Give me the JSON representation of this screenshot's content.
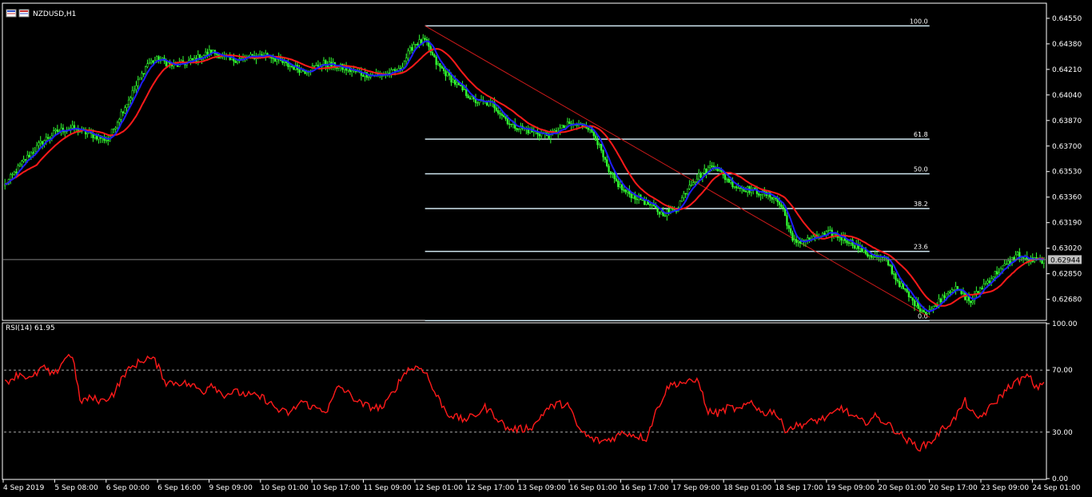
{
  "window": {
    "symbol_title": "NZDUSD,H1",
    "current_price": "0.62944",
    "icons": [
      "chart-window-icon",
      "chart-properties-icon"
    ]
  },
  "colors": {
    "background": "#000000",
    "panel_border": "#ffffff",
    "candle": "#33ff33",
    "fast_ma": "#1e1eff",
    "slow_ma": "#ff1a1a",
    "fib_line": "#cfe6f0",
    "trend_line": "#cc1a1a",
    "rsi_line": "#ff1a1a",
    "level_line": "#c0c0c0",
    "price_line": "#808080",
    "price_tag_bg": "#c0c0c0"
  },
  "chart_data": [
    {
      "type": "candlestick",
      "title": "NZDUSD,H1",
      "ylim": [
        0.6255,
        0.6464
      ],
      "y_ticks": [
        "0.64550",
        "0.64380",
        "0.64210",
        "0.64040",
        "0.63870",
        "0.63700",
        "0.63530",
        "0.63360",
        "0.63190",
        "0.63020",
        "0.62850",
        "0.62680"
      ],
      "x_ticks": [
        "4 Sep 2019",
        "5 Sep 08:00",
        "6 Sep 00:00",
        "6 Sep 16:00",
        "9 Sep 09:00",
        "10 Sep 01:00",
        "10 Sep 17:00",
        "11 Sep 09:00",
        "12 Sep 01:00",
        "12 Sep 17:00",
        "13 Sep 09:00",
        "16 Sep 01:00",
        "16 Sep 17:00",
        "17 Sep 09:00",
        "18 Sep 01:00",
        "18 Sep 17:00",
        "19 Sep 09:00",
        "20 Sep 01:00",
        "20 Sep 17:00",
        "23 Sep 09:00",
        "24 Sep 01:00"
      ],
      "close_anchors": [
        [
          0,
          0.6344
        ],
        [
          10,
          0.636
        ],
        [
          20,
          0.6373
        ],
        [
          28,
          0.638
        ],
        [
          35,
          0.6382
        ],
        [
          45,
          0.6378
        ],
        [
          55,
          0.6374
        ],
        [
          62,
          0.6392
        ],
        [
          70,
          0.641
        ],
        [
          76,
          0.6425
        ],
        [
          82,
          0.6428
        ],
        [
          90,
          0.6423
        ],
        [
          100,
          0.6427
        ],
        [
          110,
          0.6433
        ],
        [
          120,
          0.6427
        ],
        [
          130,
          0.6429
        ],
        [
          140,
          0.6431
        ],
        [
          150,
          0.6424
        ],
        [
          160,
          0.642
        ],
        [
          170,
          0.6425
        ],
        [
          180,
          0.6422
        ],
        [
          190,
          0.6418
        ],
        [
          200,
          0.6417
        ],
        [
          210,
          0.642
        ],
        [
          218,
          0.6438
        ],
        [
          224,
          0.644
        ],
        [
          230,
          0.6425
        ],
        [
          240,
          0.6412
        ],
        [
          250,
          0.64
        ],
        [
          260,
          0.6398
        ],
        [
          270,
          0.6384
        ],
        [
          280,
          0.638
        ],
        [
          290,
          0.6377
        ],
        [
          300,
          0.6384
        ],
        [
          310,
          0.6384
        ],
        [
          315,
          0.6376
        ],
        [
          322,
          0.6352
        ],
        [
          330,
          0.634
        ],
        [
          340,
          0.6334
        ],
        [
          350,
          0.6325
        ],
        [
          358,
          0.6328
        ],
        [
          365,
          0.6345
        ],
        [
          372,
          0.6352
        ],
        [
          378,
          0.6358
        ],
        [
          383,
          0.635
        ],
        [
          390,
          0.6343
        ],
        [
          400,
          0.634
        ],
        [
          410,
          0.6336
        ],
        [
          415,
          0.6328
        ],
        [
          420,
          0.6306
        ],
        [
          430,
          0.6308
        ],
        [
          440,
          0.6312
        ],
        [
          450,
          0.6307
        ],
        [
          460,
          0.6298
        ],
        [
          470,
          0.6294
        ],
        [
          475,
          0.6282
        ],
        [
          483,
          0.6268
        ],
        [
          490,
          0.626
        ],
        [
          495,
          0.6262
        ],
        [
          500,
          0.627
        ],
        [
          505,
          0.6276
        ],
        [
          510,
          0.6272
        ],
        [
          515,
          0.6266
        ],
        [
          520,
          0.6275
        ],
        [
          528,
          0.6285
        ],
        [
          535,
          0.6292
        ],
        [
          540,
          0.6298
        ],
        [
          545,
          0.6294
        ]
      ],
      "series": [
        {
          "name": "",
          "kind": "ma_fast",
          "period": 6
        },
        {
          "name": "",
          "kind": "ma_slow",
          "period": 18
        }
      ],
      "fibonacci": {
        "levels": [
          {
            "label": "100.0",
            "price": 0.645
          },
          {
            "label": "61.8",
            "price": 0.63746
          },
          {
            "label": "50.0",
            "price": 0.63515
          },
          {
            "label": "38.2",
            "price": 0.63284
          },
          {
            "label": "23.6",
            "price": 0.62999
          },
          {
            "label": "0.0",
            "price": 0.62538
          }
        ],
        "start_bar": 224,
        "end_bar": 493
      },
      "trend_line": {
        "from": [
          224,
          0.645
        ],
        "to": [
          493,
          0.6256
        ]
      },
      "current_price": 0.62944
    },
    {
      "type": "line",
      "title": "RSI(14) 61.95",
      "ylim": [
        0,
        100
      ],
      "y_ticks": [
        "100.00",
        "70.00",
        "30.00",
        "0.00"
      ],
      "levels": [
        70,
        30
      ],
      "anchors": [
        [
          0,
          62
        ],
        [
          8,
          68
        ],
        [
          14,
          64
        ],
        [
          20,
          72
        ],
        [
          26,
          66
        ],
        [
          32,
          78
        ],
        [
          36,
          80
        ],
        [
          40,
          50
        ],
        [
          46,
          52
        ],
        [
          52,
          50
        ],
        [
          58,
          55
        ],
        [
          64,
          68
        ],
        [
          70,
          74
        ],
        [
          76,
          78
        ],
        [
          80,
          76
        ],
        [
          86,
          62
        ],
        [
          94,
          62
        ],
        [
          100,
          60
        ],
        [
          106,
          56
        ],
        [
          110,
          62
        ],
        [
          116,
          54
        ],
        [
          122,
          56
        ],
        [
          130,
          54
        ],
        [
          138,
          52
        ],
        [
          146,
          44
        ],
        [
          152,
          42
        ],
        [
          158,
          50
        ],
        [
          164,
          46
        ],
        [
          172,
          44
        ],
        [
          178,
          60
        ],
        [
          184,
          54
        ],
        [
          190,
          48
        ],
        [
          196,
          46
        ],
        [
          202,
          46
        ],
        [
          208,
          58
        ],
        [
          214,
          70
        ],
        [
          220,
          72
        ],
        [
          224,
          70
        ],
        [
          228,
          58
        ],
        [
          236,
          42
        ],
        [
          244,
          38
        ],
        [
          250,
          40
        ],
        [
          256,
          46
        ],
        [
          262,
          40
        ],
        [
          268,
          32
        ],
        [
          276,
          32
        ],
        [
          282,
          34
        ],
        [
          288,
          44
        ],
        [
          294,
          48
        ],
        [
          300,
          48
        ],
        [
          306,
          32
        ],
        [
          312,
          26
        ],
        [
          318,
          24
        ],
        [
          324,
          26
        ],
        [
          330,
          30
        ],
        [
          336,
          28
        ],
        [
          342,
          26
        ],
        [
          348,
          46
        ],
        [
          354,
          60
        ],
        [
          360,
          62
        ],
        [
          366,
          62
        ],
        [
          370,
          64
        ],
        [
          374,
          44
        ],
        [
          380,
          42
        ],
        [
          386,
          46
        ],
        [
          392,
          44
        ],
        [
          398,
          50
        ],
        [
          404,
          42
        ],
        [
          410,
          44
        ],
        [
          416,
          32
        ],
        [
          422,
          34
        ],
        [
          428,
          36
        ],
        [
          434,
          38
        ],
        [
          440,
          40
        ],
        [
          446,
          46
        ],
        [
          452,
          40
        ],
        [
          458,
          36
        ],
        [
          464,
          40
        ],
        [
          470,
          36
        ],
        [
          476,
          30
        ],
        [
          482,
          24
        ],
        [
          488,
          20
        ],
        [
          494,
          24
        ],
        [
          500,
          32
        ],
        [
          506,
          38
        ],
        [
          512,
          50
        ],
        [
          518,
          38
        ],
        [
          524,
          44
        ],
        [
          530,
          52
        ],
        [
          536,
          60
        ],
        [
          542,
          64
        ],
        [
          546,
          66
        ],
        [
          550,
          58
        ],
        [
          553,
          62
        ]
      ]
    }
  ]
}
